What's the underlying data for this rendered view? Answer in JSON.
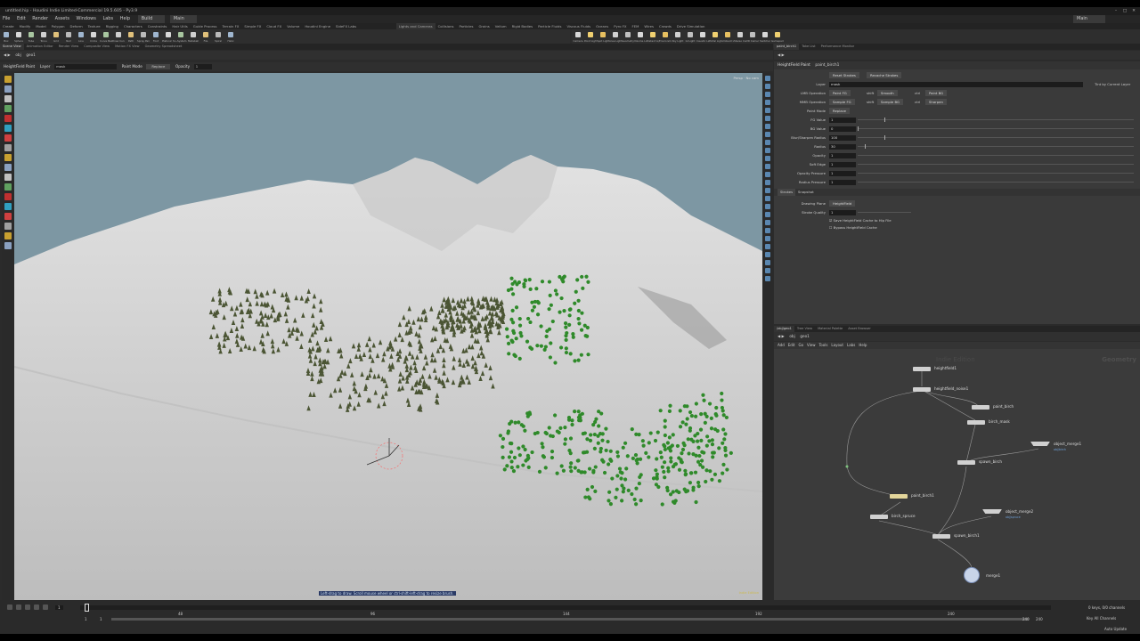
{
  "window": {
    "title": "untitled.hip - Houdini Indie Limited-Commercial 19.5.605 - Py3.9",
    "controls": [
      "–",
      "□",
      "✕"
    ]
  },
  "menu": [
    "File",
    "Edit",
    "Render",
    "Assets",
    "Windows",
    "Labs",
    "Help"
  ],
  "desktop": {
    "build": "Build",
    "main": "Main",
    "right_main": "Main"
  },
  "shelf_tabs_left": [
    "Create",
    "Modify",
    "Model",
    "Polygon",
    "Deform",
    "Texture",
    "Rigging",
    "Characters",
    "Constraints",
    "Hair Utils",
    "Guide Process",
    "Terrain FX",
    "Simple FX",
    "Cloud FX",
    "Volume",
    "Houdini Engine",
    "SideFX Labs"
  ],
  "shelf_tabs_right": [
    "Lights and Cameras",
    "Collisions",
    "Particles",
    "Grains",
    "Vellum",
    "Rigid Bodies",
    "Particle Fluids",
    "Viscous Fluids",
    "Oceans",
    "Pyro FX",
    "FEM",
    "Wires",
    "Crowds",
    "Drive Simulation"
  ],
  "tools_left": [
    "Box",
    "Sphere",
    "Tube",
    "Torus",
    "Grid",
    "Null",
    "Line",
    "Circle",
    "Curve Bezier",
    "Draw Curve",
    "Path",
    "Spray Paint",
    "Font",
    "Platonic Solids",
    "L-System",
    "Metaball",
    "File",
    "Spiral",
    "Helix"
  ],
  "tools_right": [
    "Camera",
    "Point Light",
    "Spot Light",
    "Area Light",
    "Geometry Light",
    "Volume Light",
    "Distant Light",
    "Environment Light",
    "Sky Light",
    "GI Light",
    "Caustic Light",
    "Portal Light",
    "Ambient Light",
    "Stereo Camera",
    "VR Camera",
    "Switcher",
    "Gamepad Camera"
  ],
  "left_pane_tabs": [
    "Scene View",
    "Animation Editor",
    "Render View",
    "Composite View",
    "Motion FX View",
    "Geometry Spreadsheet"
  ],
  "right_pane_tabs_top": [
    "paint_birch1",
    "Take List",
    "Performance Monitor"
  ],
  "viewport_path": {
    "obj": "obj",
    "geo": "geo1"
  },
  "tool_options": {
    "tool": "HeightField Paint",
    "layer_label": "Layer",
    "layer": "mask",
    "paint_mode_label": "Paint Mode",
    "paint_mode": "Replace",
    "opacity_label": "Opacity",
    "opacity": "1"
  },
  "viewport": {
    "camera": "Persp",
    "cam2": "No cam",
    "hint": "Left-drag to draw. Scroll mouse wheel or ctrl-shift-left-drag to resize brush.",
    "status_right": "Indie Edition"
  },
  "params": {
    "node_type": "HeightField Paint",
    "node_name": "paint_birch1",
    "reset_btn": "Reset Strokes",
    "recache_btn": "Recache Strokes",
    "layer_label": "Layer",
    "layer": "mask",
    "tint_label": "Tint by Current Layer",
    "lmb_label": "LMB Operation",
    "lmb": "Paint FG",
    "shift": "shift",
    "lmb_shift": "Smooth",
    "ctrl": "ctrl",
    "lmb_ctrl": "Paint BG",
    "mmb_label": "MMB Operation",
    "mmb": "Sample FG",
    "mmb_shift": "Sample BG",
    "mmb_ctrl": "Sharpen",
    "paintmode_label": "Paint Mode",
    "paintmode": "Replace",
    "fg_label": "FG Value",
    "fg": "1",
    "bg_label": "BG Value",
    "bg": "0",
    "blur_label": "Blur/Sharpen Radius",
    "blur": "100",
    "radius_label": "Radius",
    "radius": "30",
    "opacity_label": "Opacity",
    "opacity": "1",
    "softedge_label": "Soft Edge",
    "softedge": "1",
    "oppress_label": "Opacity Pressure",
    "oppress": "1",
    "radpress_label": "Radius Pressure",
    "radpress": "1",
    "tab_strokes": "Strokes",
    "tab_snapshot": "Snapshot",
    "drawplane_label": "Drawing Plane",
    "drawplane": "HeightField",
    "quality_label": "Stroke Quality",
    "quality": "1",
    "save_cache": "Save HeightField Cache to Hip File",
    "bypass_cache": "Bypass HeightField Cache"
  },
  "net_tabs": [
    "/obj/geo1",
    "Tree View",
    "Material Palette",
    "Asset Browser"
  ],
  "net_path": {
    "obj": "obj",
    "geo": "geo1"
  },
  "net_menu": [
    "Add",
    "Edit",
    "Go",
    "View",
    "Tools",
    "Layout",
    "Labs",
    "Help"
  ],
  "net_watermark": "Indie Edition",
  "net_context": "Geometry",
  "nodes": {
    "hf": "heightfield1",
    "noise": "heightfield_noise1",
    "paint_birch": "paint_birch",
    "birch_mask": "birch_mask",
    "spawn_birch": "spawn_birch",
    "paint_birch1": "paint_birch1",
    "birch_spruce": "birch_spruce",
    "spawn_birch1": "spawn_birch1",
    "merge": "merge1",
    "obj_merge1": "object_merge1",
    "obj_merge1_sub": "obj/birch",
    "obj_merge2": "object_merge2",
    "obj_merge2_sub": "obj/spruce"
  },
  "timeline": {
    "start": "1",
    "end": "240",
    "current": "1",
    "range_start": "1",
    "range_end": "240",
    "ticks": [
      "1",
      "48",
      "96",
      "144",
      "192",
      "240"
    ],
    "keys": "0 keys, 0/0 channels",
    "key_all": "Key All Channels",
    "auto_update": "Auto Update"
  },
  "colors": {
    "sky": "#7d97a3",
    "terrain": "#d6d6d6",
    "dark_trees": "#4b5534",
    "green_trees": "#2f8a2a",
    "node_selected": "#e3d59a"
  }
}
